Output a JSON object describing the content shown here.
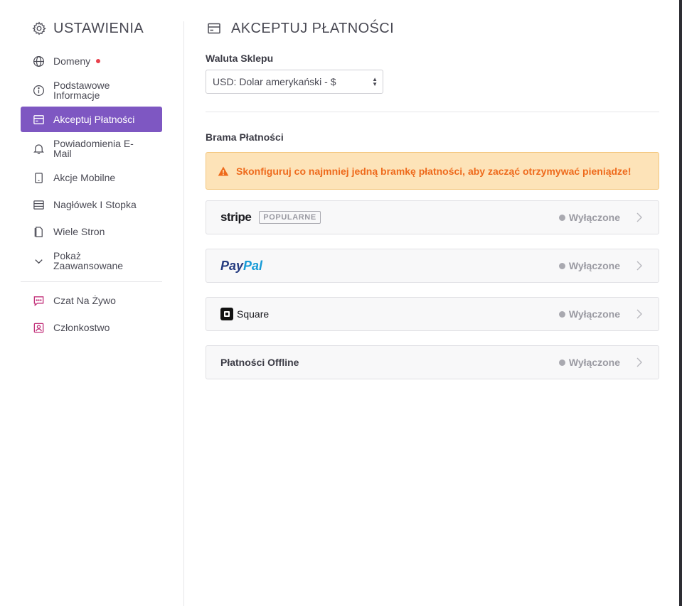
{
  "sidebar": {
    "title": "USTAWIENIA",
    "title_icon": "gear-icon",
    "items": [
      {
        "label": "Domeny",
        "icon": "globe-icon",
        "badge_color": "#e8404c"
      },
      {
        "label": "Podstawowe Informacje",
        "icon": "info-icon"
      },
      {
        "label": "Akceptuj Płatności",
        "icon": "card-icon",
        "active": true
      },
      {
        "label": "Powiadomienia E-Mail",
        "icon": "bell-icon"
      },
      {
        "label": "Akcje Mobilne",
        "icon": "mobile-icon"
      },
      {
        "label": "Nagłówek I Stopka",
        "icon": "layout-icon"
      },
      {
        "label": "Wiele Stron",
        "icon": "pages-icon"
      },
      {
        "label": "Pokaż Zaawansowane",
        "icon": "chevron-down-icon"
      }
    ],
    "extra_items": [
      {
        "label": "Czat Na Żywo",
        "icon": "chat-icon"
      },
      {
        "label": "Członkostwo",
        "icon": "member-icon"
      }
    ],
    "accent_color": "#7e57c2"
  },
  "main": {
    "title": "AKCEPTUJ PŁATNOŚCI",
    "currency": {
      "label": "Waluta Sklepu",
      "selected": "USD: Dolar amerykański - $"
    },
    "gateways": {
      "label": "Brama Płatności",
      "alert": "Skonfiguruj co najmniej jedną bramkę płatności, aby zacząć otrzymywać pieniądze!",
      "alert_color": "#ee6a1c",
      "items": [
        {
          "name": "stripe",
          "badge": "POPULARNE",
          "status": "Wyłączone"
        },
        {
          "name_part1": "Pay",
          "name_part2": "Pal",
          "status": "Wyłączone"
        },
        {
          "name": "Square",
          "status": "Wyłączone"
        },
        {
          "name": "Płatności Offline",
          "status": "Wyłączone"
        }
      ]
    }
  }
}
